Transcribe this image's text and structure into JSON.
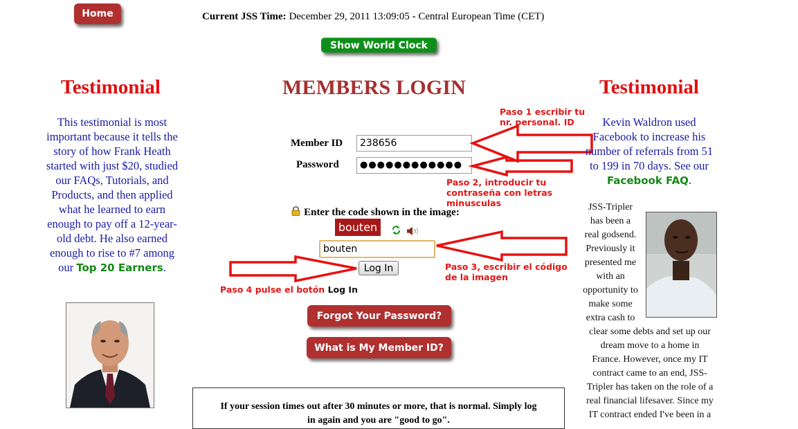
{
  "nav": {
    "home_label": "Home"
  },
  "clock": {
    "label": "Current JSS Time:",
    "value": "December 29, 2011 13:09:05",
    "zone": " - Central European Time (CET)",
    "world_clock_label": "Show World Clock"
  },
  "left_testimonial": {
    "title": "Testimonial",
    "text": "This testimonial is most important because it tells the story of how Frank Heath started with just $20, studied our FAQs, Tutorials, and Products, and then applied what he learned to earn enough to pay off a 12-year-old debt. He also earned enough to rise to #7 among our ",
    "link": "Top 20 Earners",
    "after": "."
  },
  "login": {
    "title": "MEMBERS LOGIN",
    "member_id_label": "Member ID",
    "member_id_value": "238656",
    "password_label": "Password",
    "password_value": "●●●●●●●●●●●●",
    "captcha_prompt": "Enter the code shown in the image:",
    "captcha_image_text": "bouten",
    "captcha_value": "bouten",
    "login_button": "Log In",
    "forgot_button": "Forgot Your Password?",
    "member_id_button": "What is My Member ID?"
  },
  "annotations": {
    "step1": "Paso 1 escribir tu nr. personal. ID",
    "step2": "Paso 2, introducir tu contraseña con letras minusculas",
    "step3": "Paso 3, escribir el código de la imagen",
    "step4_prefix": "Paso 4 pulse el botón ",
    "step4_suffix": "Log In"
  },
  "right_testimonial": {
    "title": "Testimonial",
    "text": "Kevin Waldron used Facebook to increase his number of referrals from 51 to 199 in 70 days. See our ",
    "link": "Facebook FAQ",
    "after": ".",
    "story_narrow": [
      "JSS-Tripler",
      "has been a",
      "real godsend.",
      "Previously it",
      "presented me",
      "with an",
      "opportunity to",
      "make some",
      "extra cash to"
    ],
    "story_wide": [
      "clear some debts and set up our",
      "dream move to a home in",
      "France. However, once my IT",
      "contract came to an end, JSS-",
      "Tripler has taken on the role of a",
      "real financial lifesaver. Since my",
      "IT contract ended I've been in a"
    ]
  },
  "session_note": {
    "line1": "If your session times out after 30 minutes or more, that is normal. Simply log",
    "line2": "in again and you are \"good to go\"."
  },
  "colors": {
    "accent_red": "#b03030",
    "green_button": "#0f8f1a",
    "testimonial_title": "#e01010",
    "testimonial_text": "#1a1aa8",
    "annotation_red": "#e01818"
  }
}
